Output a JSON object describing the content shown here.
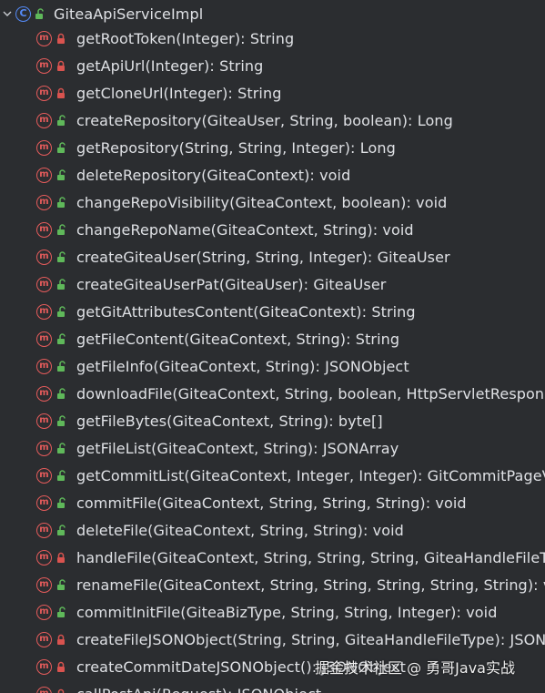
{
  "structure_panel": {
    "class_node": {
      "name": "GiteaApiServiceImpl",
      "icon": "class-icon",
      "icon_letter": "C",
      "visibility": "public"
    },
    "methods": [
      {
        "signature": "getRootToken(Integer): String",
        "visibility": "private"
      },
      {
        "signature": "getApiUrl(Integer): String",
        "visibility": "private"
      },
      {
        "signature": "getCloneUrl(Integer): String",
        "visibility": "private"
      },
      {
        "signature": "createRepository(GiteaUser, String, boolean): Long",
        "visibility": "public"
      },
      {
        "signature": "getRepository(String, String, Integer): Long",
        "visibility": "public"
      },
      {
        "signature": "deleteRepository(GiteaContext): void",
        "visibility": "public"
      },
      {
        "signature": "changeRepoVisibility(GiteaContext, boolean): void",
        "visibility": "public"
      },
      {
        "signature": "changeRepoName(GiteaContext, String): void",
        "visibility": "public"
      },
      {
        "signature": "createGiteaUser(String, String, Integer): GiteaUser",
        "visibility": "public"
      },
      {
        "signature": "createGiteaUserPat(GiteaUser): GiteaUser",
        "visibility": "public"
      },
      {
        "signature": "getGitAttributesContent(GiteaContext): String",
        "visibility": "public"
      },
      {
        "signature": "getFileContent(GiteaContext, String): String",
        "visibility": "public"
      },
      {
        "signature": "getFileInfo(GiteaContext, String): JSONObject",
        "visibility": "public"
      },
      {
        "signature": "downloadFile(GiteaContext, String, boolean, HttpServletResponse):",
        "visibility": "public"
      },
      {
        "signature": "getFileBytes(GiteaContext, String): byte[]",
        "visibility": "public"
      },
      {
        "signature": "getFileList(GiteaContext, String): JSONArray",
        "visibility": "public"
      },
      {
        "signature": "getCommitList(GiteaContext, Integer, Integer): GitCommitPageVO",
        "visibility": "public"
      },
      {
        "signature": "commitFile(GiteaContext, String, String, String): void",
        "visibility": "public"
      },
      {
        "signature": "deleteFile(GiteaContext, String, String): void",
        "visibility": "public"
      },
      {
        "signature": "handleFile(GiteaContext, String, String, String, GiteaHandleFileType)",
        "visibility": "private"
      },
      {
        "signature": "renameFile(GiteaContext, String, String, String, String, String): void",
        "visibility": "public"
      },
      {
        "signature": "commitInitFile(GiteaBizType, String, String, Integer): void",
        "visibility": "public"
      },
      {
        "signature": "createFileJSONObject(String, String, GiteaHandleFileType): JSONOb",
        "visibility": "private"
      },
      {
        "signature": "createCommitDateJSONObject(): JSONObject",
        "visibility": "private"
      },
      {
        "signature": "callPostApi(Request): JSONObject",
        "visibility": "private"
      }
    ],
    "method_icon_letter": "m"
  },
  "watermark": {
    "text": "掘金技术社区 @ 勇哥Java实战"
  },
  "colors": {
    "background": "#2b2d30",
    "text": "#dfe1e5",
    "class_icon": "#548af7",
    "method_icon": "#e55b5b",
    "private_lock": "#d9534f",
    "public_lock": "#5fb85a"
  }
}
